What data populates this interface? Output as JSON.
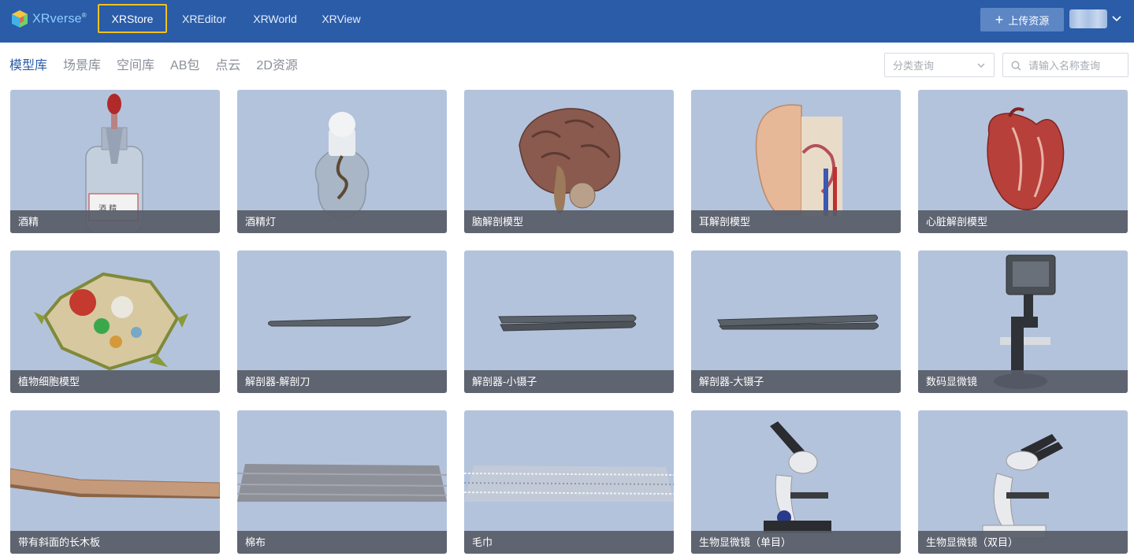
{
  "brand": {
    "name": "XRverse",
    "mark": "®"
  },
  "nav": {
    "items": [
      {
        "label": "XRStore",
        "active": true
      },
      {
        "label": "XREditor",
        "active": false
      },
      {
        "label": "XRWorld",
        "active": false
      },
      {
        "label": "XRView",
        "active": false
      }
    ]
  },
  "header": {
    "upload_label": "上传资源"
  },
  "categories": [
    {
      "label": "模型库",
      "active": true
    },
    {
      "label": "场景库",
      "active": false
    },
    {
      "label": "空间库",
      "active": false
    },
    {
      "label": "AB包",
      "active": false
    },
    {
      "label": "点云",
      "active": false
    },
    {
      "label": "2D资源",
      "active": false
    }
  ],
  "filter": {
    "select_placeholder": "分类查询",
    "search_placeholder": "请输入名称查询"
  },
  "models": [
    {
      "name": "酒精",
      "icon": "alcohol-bottle"
    },
    {
      "name": "酒精灯",
      "icon": "alcohol-lamp"
    },
    {
      "name": "脑解剖模型",
      "icon": "brain"
    },
    {
      "name": "耳解剖模型",
      "icon": "ear"
    },
    {
      "name": "心脏解剖模型",
      "icon": "heart"
    },
    {
      "name": "植物细胞模型",
      "icon": "plant-cell"
    },
    {
      "name": "解剖器-解剖刀",
      "icon": "scalpel"
    },
    {
      "name": "解剖器-小镊子",
      "icon": "small-tweezers"
    },
    {
      "name": "解剖器-大镊子",
      "icon": "large-tweezers"
    },
    {
      "name": "数码显微镜",
      "icon": "digital-microscope"
    },
    {
      "name": "带有斜面的长木板",
      "icon": "wooden-plank"
    },
    {
      "name": "棉布",
      "icon": "cotton-cloth"
    },
    {
      "name": "毛巾",
      "icon": "towel"
    },
    {
      "name": "生物显微镜（单目）",
      "icon": "monocular-microscope"
    },
    {
      "name": "生物显微镜（双目）",
      "icon": "binocular-microscope"
    }
  ]
}
